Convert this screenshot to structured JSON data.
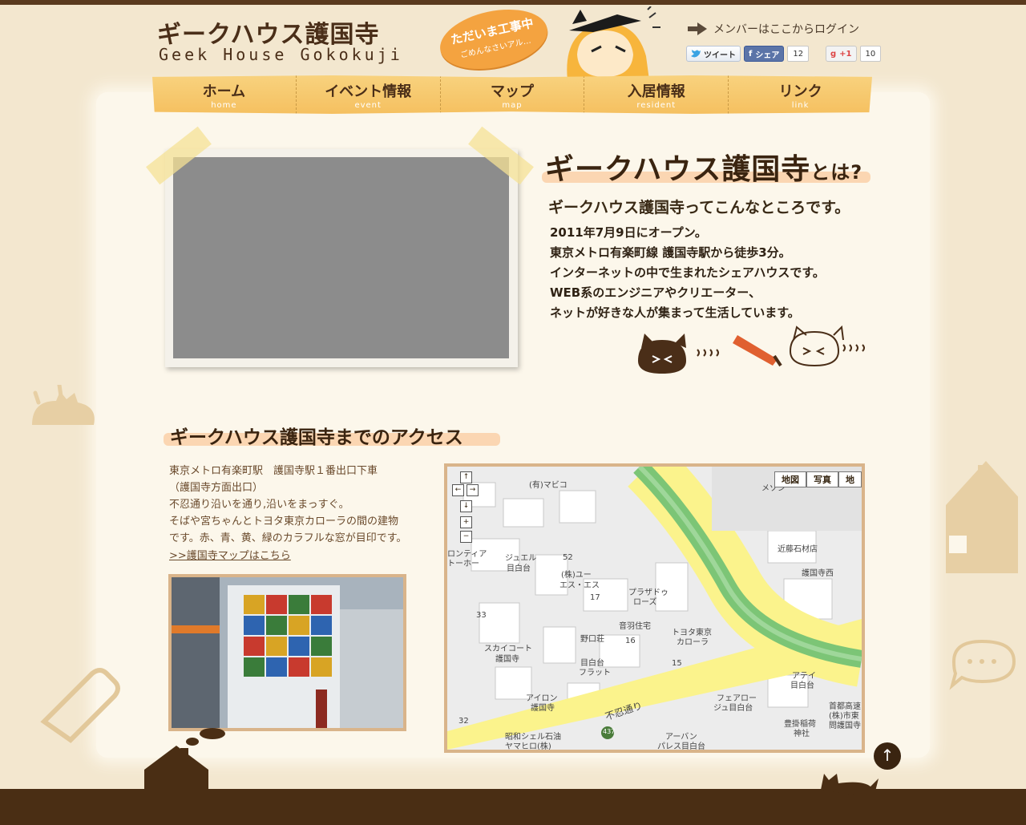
{
  "header": {
    "logo_jp": "ギークハウス護国寺",
    "logo_en": "Geek House Gokokuji",
    "bubble_line1": "ただいま工事中",
    "bubble_line2": "ごめんなさいアル…",
    "login_label": "メンバーはここからログイン"
  },
  "social": {
    "tweet_label": "ツイート",
    "share_label": "シェア",
    "share_count": "12",
    "plusone_label": "+1",
    "plusone_count": "10"
  },
  "nav": [
    {
      "label": "ホーム",
      "sub": "home"
    },
    {
      "label": "イベント情報",
      "sub": "event"
    },
    {
      "label": "マップ",
      "sub": "map"
    },
    {
      "label": "入居情報",
      "sub": "resident"
    },
    {
      "label": "リンク",
      "sub": "link"
    }
  ],
  "about": {
    "title": "ギークハウス護国寺",
    "title_suffix": "とは?",
    "subtitle": "ギークハウス護国寺ってこんなところです。",
    "lines": [
      "2011年7月9日にオープン。",
      "東京メトロ有楽町線 護国寺駅から徒歩3分。",
      "インターネットの中で生まれたシェアハウスです。",
      "WEB系のエンジニアやクリエーター、",
      "ネットが好きな人が集まって生活しています。"
    ]
  },
  "access": {
    "title": "ギークハウス護国寺までのアクセス",
    "lines": [
      "東京メトロ有楽町駅　護国寺駅１番出口下車",
      "（護国寺方面出口）",
      "不忍通り沿いを通り,沿いをまっすぐ。",
      "そばや宮ちゃんとトヨタ東京カローラの間の建物",
      "です。赤、青、黄、緑のカラフルな窓が目印です。"
    ],
    "link": ">>護国寺マップはこちら"
  },
  "map": {
    "type_map": "地図",
    "type_photo": "写真",
    "type_more": "地",
    "labels": [
      "(有)マビコ",
      "ジュエル",
      "目白台",
      "(株)ユー",
      "エス・エス",
      "プラザドゥ",
      "ローズ",
      "音羽住宅",
      "野口荘",
      "目白台",
      "フラット",
      "トヨタ東京",
      "カローラ",
      "スカイコート",
      "護国寺",
      "アイロン",
      "護国寺",
      "不忍通り",
      "昭和シェル石油",
      "ヤマヒロ(株)",
      "アーバン",
      "パレス目白台",
      "フェアロー",
      "ジュ目白台",
      "アテイ",
      "目白台",
      "近藤石材店",
      "護国寺西",
      "首都高速",
      "(株)市東",
      "問護国寺",
      "豊掛稲荷",
      "神社",
      "メゾン",
      "ロンティア",
      "トーホー",
      "52",
      "17",
      "33",
      "16",
      "15",
      "32",
      "437"
    ]
  },
  "colors": {
    "paper": "#fcf7eb",
    "nav": "#f5c060",
    "accent_orange": "#f4a340",
    "highlight": "#fbd6b2",
    "ground": "#4a2e14"
  }
}
